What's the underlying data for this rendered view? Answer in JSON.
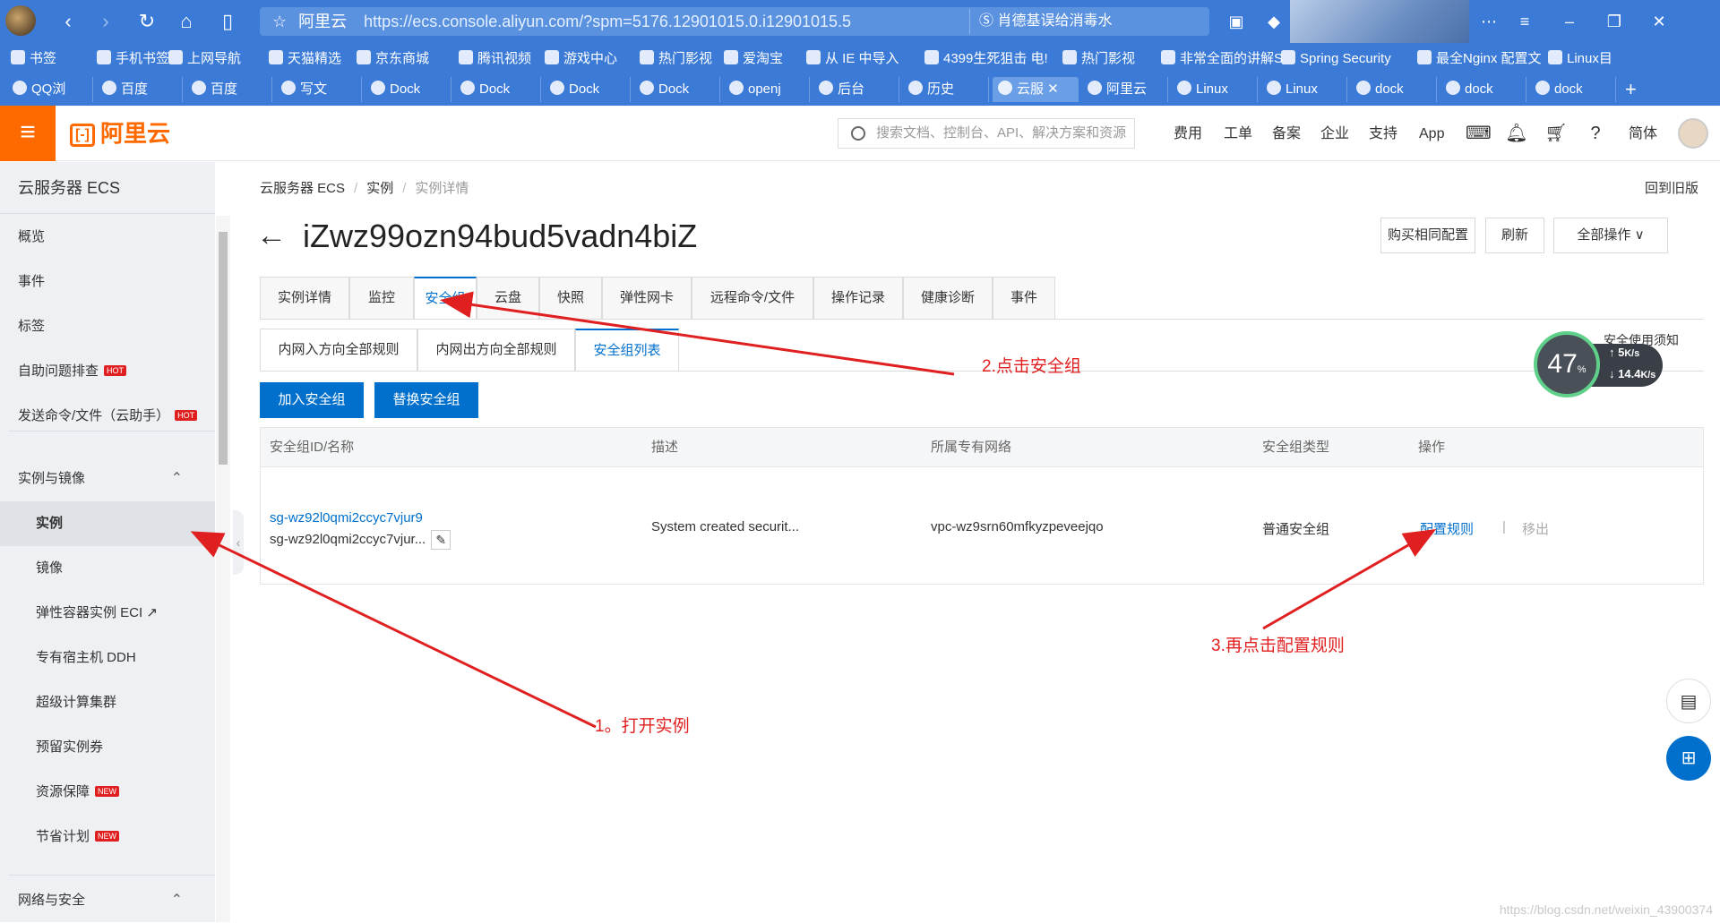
{
  "browser": {
    "site_name": "阿里云",
    "url": "https://ecs.console.aliyun.com/?spm=5176.12901015.0.i12901015.5",
    "hot_search": "肖德基误给消毒水"
  },
  "bookmarks": [
    "书签",
    "手机书签",
    "上网导航",
    "天猫精选",
    "京东商城",
    "腾讯视频",
    "游戏中心",
    "热门影视",
    "爱淘宝",
    "从 IE 中导入",
    "4399生死狙击 电!",
    "热门影视",
    "非常全面的讲解S",
    "Spring Security",
    "最全Nginx 配置文",
    "Linux目"
  ],
  "tabs": [
    "QQ浏",
    "百度",
    "百度",
    "写文",
    "Dock",
    "Dock",
    "Dock",
    "Dock",
    "openj",
    "后台",
    "历史",
    "云服",
    "阿里云",
    "Linux",
    "Linux",
    "dock",
    "dock",
    "dock"
  ],
  "header": {
    "logo": "阿里云",
    "search_placeholder": "搜索文档、控制台、API、解决方案和资源",
    "links": [
      "费用",
      "工单",
      "备案",
      "企业",
      "支持",
      "App"
    ],
    "lang": "简体"
  },
  "sidebar": {
    "title": "云服务器 ECS",
    "items": [
      {
        "label": "概览"
      },
      {
        "label": "事件"
      },
      {
        "label": "标签"
      },
      {
        "label": "自助问题排查",
        "badge": "HOT"
      },
      {
        "label": "发送命令/文件（云助手）",
        "badge": "HOT"
      },
      {
        "label": "实例与镜像"
      },
      {
        "label": "实例"
      },
      {
        "label": "镜像"
      },
      {
        "label": "弹性容器实例 ECI ↗"
      },
      {
        "label": "专有宿主机 DDH"
      },
      {
        "label": "超级计算集群"
      },
      {
        "label": "预留实例券"
      },
      {
        "label": "资源保障",
        "badge": "NEW"
      },
      {
        "label": "节省计划",
        "badge": "NEW"
      },
      {
        "label": "网络与安全"
      }
    ]
  },
  "breadcrumb": [
    "云服务器 ECS",
    "实例",
    "实例详情"
  ],
  "old_version": "回到旧版",
  "instance": {
    "title": "iZwz99ozn94bud5vadn4biZ"
  },
  "actions": {
    "buy_same": "购买相同配置",
    "refresh": "刷新",
    "all_ops": "全部操作 ∨"
  },
  "detail_tabs": [
    "实例详情",
    "监控",
    "安全组",
    "云盘",
    "快照",
    "弹性网卡",
    "远程命令/文件",
    "操作记录",
    "健康诊断",
    "事件"
  ],
  "sub_tabs": [
    "内网入方向全部规则",
    "内网出方向全部规则",
    "安全组列表"
  ],
  "buttons": {
    "join": "加入安全组",
    "replace": "替换安全组"
  },
  "table": {
    "headers": [
      "安全组ID/名称",
      "描述",
      "所属专有网络",
      "安全组类型",
      "操作"
    ],
    "rows": [
      {
        "id": "sg-wz92l0qmi2ccyc7vjur9",
        "name": "sg-wz92l0qmi2ccyc7vjur...",
        "desc": "System created securit...",
        "vpc": "vpc-wz9srn60mfkyzpeveejqo",
        "type": "普通安全组",
        "op_config": "配置规则",
        "op_sep": "|",
        "op_remove": "移出"
      }
    ]
  },
  "speed": {
    "percent": "47",
    "unit": "%",
    "up": "5",
    "up_unit": "K/s",
    "down": "14.4",
    "down_unit": "K/s",
    "notice": "安全使用须知"
  },
  "annotations": {
    "step1": "1。打开实例",
    "step2": "2.点击安全组",
    "step3": "3.再点击配置规则",
    "color": "#e02020"
  },
  "watermark": "https://blog.csdn.net/weixin_43900374"
}
